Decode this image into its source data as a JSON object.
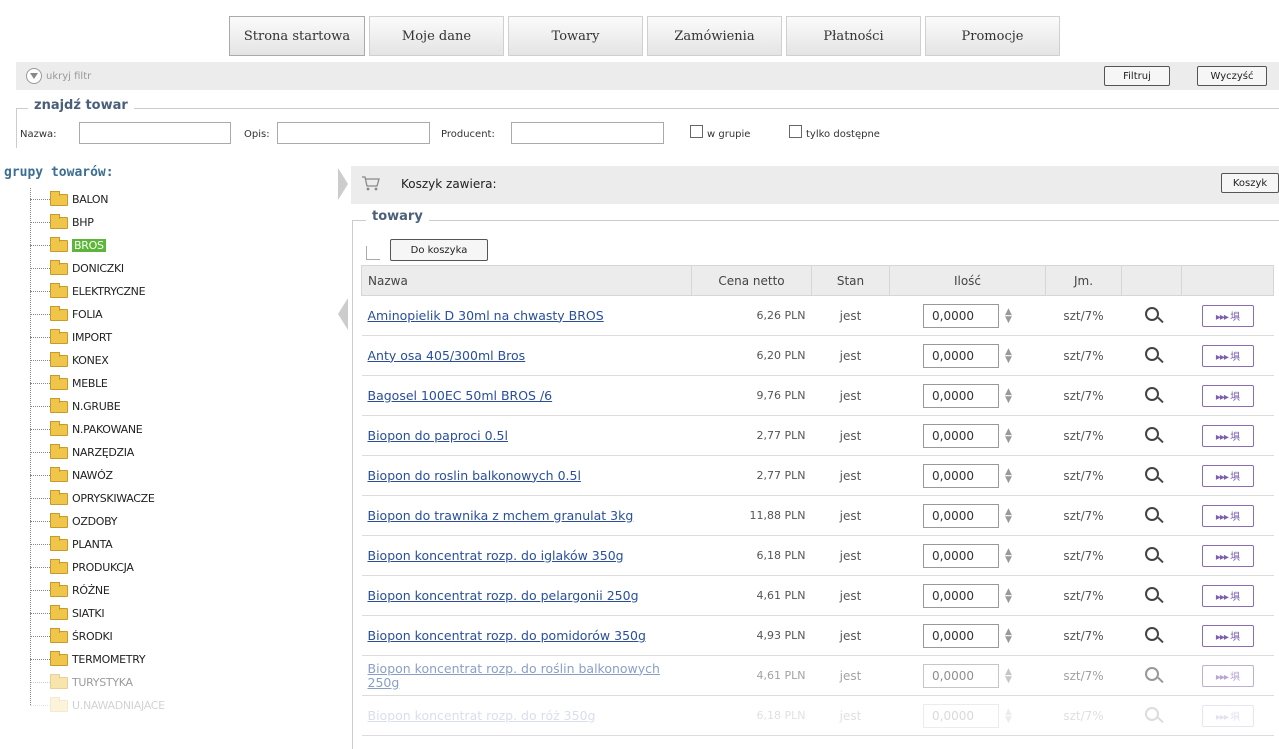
{
  "nav": {
    "tabs": [
      "Strona startowa",
      "Moje dane",
      "Towary",
      "Zamówienia",
      "Płatności",
      "Promocje"
    ]
  },
  "filterbar": {
    "hide_filter": "ukryj filtr",
    "filter_button": "Filtruj",
    "clear_button": "Wyczyść"
  },
  "search": {
    "legend": "znajdź towar",
    "name_label": "Nazwa:",
    "name_value": "",
    "desc_label": "Opis:",
    "desc_value": "",
    "producer_label": "Producent:",
    "producer_value": "",
    "in_group_label": "w grupie",
    "available_only_label": "tylko dostępne"
  },
  "tree": {
    "title": "grupy towarów:",
    "groups": [
      "BALON",
      "BHP",
      "BROS",
      "DONICZKI",
      "ELEKTRYCZNE",
      "FOLIA",
      "IMPORT",
      "KONEX",
      "MEBLE",
      "N.GRUBE",
      "N.PAKOWANE",
      "NARZĘDZIA",
      "NAWÓZ",
      "OPRYSKIWACZE",
      "OZDOBY",
      "PLANTA",
      "PRODUKCJA",
      "RÓŻNE",
      "SIATKI",
      "ŚRODKI",
      "TERMOMETRY",
      "TURYSTYKA",
      "U.NAWADNIAJACE"
    ],
    "selected": "BROS"
  },
  "cart": {
    "label": "Koszyk zawiera:",
    "button": "Koszyk"
  },
  "products": {
    "legend": "towary",
    "add_to_cart_button": "Do koszyka",
    "columns": [
      "Nazwa",
      "Cena netto",
      "Stan",
      "Ilość",
      "Jm.",
      "",
      ""
    ],
    "add_icon_text": "▸▸▸ 埧",
    "rows": [
      {
        "name": "Aminopielik D 30ml na chwasty BROS",
        "price": "6,26 PLN",
        "stock": "jest",
        "qty": "0,0000",
        "unit": "szt/7%"
      },
      {
        "name": "Anty osa 405/300ml Bros",
        "price": "6,20 PLN",
        "stock": "jest",
        "qty": "0,0000",
        "unit": "szt/7%"
      },
      {
        "name": "Bagosel 100EC 50ml BROS /6",
        "price": "9,76 PLN",
        "stock": "jest",
        "qty": "0,0000",
        "unit": "szt/7%"
      },
      {
        "name": "Biopon do paproci 0.5l",
        "price": "2,77 PLN",
        "stock": "jest",
        "qty": "0,0000",
        "unit": "szt/7%"
      },
      {
        "name": "Biopon do roslin balkonowych 0.5l",
        "price": "2,77 PLN",
        "stock": "jest",
        "qty": "0,0000",
        "unit": "szt/7%"
      },
      {
        "name": "Biopon do trawnika z mchem granulat 3kg",
        "price": "11,88 PLN",
        "stock": "jest",
        "qty": "0,0000",
        "unit": "szt/7%"
      },
      {
        "name": "Biopon koncentrat rozp. do iglaków 350g",
        "price": "6,18 PLN",
        "stock": "jest",
        "qty": "0,0000",
        "unit": "szt/7%"
      },
      {
        "name": "Biopon koncentrat rozp. do pelargonii 250g",
        "price": "4,61 PLN",
        "stock": "jest",
        "qty": "0,0000",
        "unit": "szt/7%"
      },
      {
        "name": "Biopon koncentrat rozp. do pomidorów 350g",
        "price": "4,93 PLN",
        "stock": "jest",
        "qty": "0,0000",
        "unit": "szt/7%"
      },
      {
        "name": "Biopon koncentrat rozp. do roślin balkonowych 250g",
        "price": "4,61 PLN",
        "stock": "jest",
        "qty": "0,0000",
        "unit": "szt/7%"
      },
      {
        "name": "Biopon koncentrat rozp. do róż 350g",
        "price": "6,18 PLN",
        "stock": "jest",
        "qty": "0,0000",
        "unit": "szt/7%"
      }
    ]
  }
}
